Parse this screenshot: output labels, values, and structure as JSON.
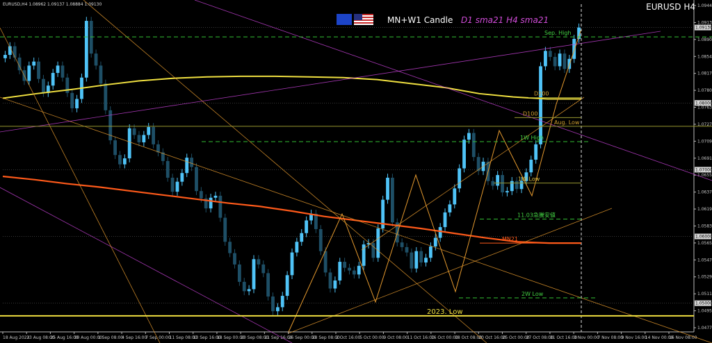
{
  "window": {
    "symbol_title": "EURUSD H4",
    "info_line": "EURUSD,H4  1.08962 1.09137 1.08884 1.09130"
  },
  "overlay": {
    "caption": "MN+W1 Candle",
    "ma_caption": "D1 sma21  H4 sma21",
    "flags": [
      "eu-flag-icon",
      "us-flag-icon"
    ]
  },
  "colors": {
    "background": "#000000",
    "bull": "#4fc3f7",
    "bear": "#1e4f66",
    "grid": "#303030",
    "sma_long": "#f0e040",
    "sma_d1": "#ff5a1a",
    "magenta": "#c040d0",
    "orange": "#e69a2e",
    "green_dash": "#34c234",
    "olive": "#9a9a30",
    "axis_text": "#c8c8c8"
  },
  "chart_data": {
    "type": "candlestick",
    "title": "EURUSD H4",
    "ylim": [
      1.0457,
      1.0948
    ],
    "y_ticks": [
      "1.09442",
      "1.09130",
      "1.08902",
      "1.08542",
      "1.08172",
      "1.07807",
      "1.07637",
      "1.07277",
      "1.07097",
      "1.06917",
      "1.06557",
      "1.06377",
      "1.06197",
      "1.05837",
      "1.05657",
      "1.05477",
      "1.05297",
      "1.05117",
      "1.04957",
      "1.04777"
    ],
    "y_highlights": [
      {
        "value": 1.0913,
        "label": "1.09130"
      },
      {
        "value": 1.08,
        "label": "1.08000"
      },
      {
        "value": 1.07,
        "label": "1.07000"
      },
      {
        "value": 1.06,
        "label": "1.06000"
      },
      {
        "value": 1.05,
        "label": "1.05000"
      }
    ],
    "x_ticks": [
      "18 Aug 2023",
      "23 Aug 08:00",
      "25 Aug 16:00",
      "30 Aug 00:00",
      "1 Sep 08:00",
      "4 Sep 16:00",
      "7 Sep 00:00",
      "11 Sep 08:00",
      "13 Sep 16:00",
      "18 Sep 00:00",
      "20 Sep 08:00",
      "21 Sep 16:00",
      "26 Sep 00:00",
      "28 Sep 08:00",
      "2 Oct 16:00",
      "5 Oct 00:00",
      "9 Oct 08:00",
      "11 Oct 16:00",
      "16 Oct 00:00",
      "18 Oct 08:00",
      "20 Oct 16:00",
      "25 Oct 00:00",
      "27 Oct 08:00",
      "31 Oct 16:00",
      "3 Nov 00:00",
      "7 Nov 08:00",
      "9 Nov 16:00",
      "14 Nov 00:00",
      "16 Nov 08:00"
    ],
    "close_path": [
      1.0872,
      1.0885,
      1.0868,
      1.0849,
      1.0833,
      1.0856,
      1.0862,
      1.0836,
      1.0815,
      1.0826,
      1.0845,
      1.0856,
      1.0838,
      1.0815,
      1.0792,
      1.0806,
      1.0838,
      1.0923,
      1.0874,
      1.0856,
      1.0829,
      1.0789,
      1.0744,
      1.0722,
      1.0708,
      1.0717,
      1.0762,
      1.0752,
      1.0741,
      1.0752,
      1.0764,
      1.0738,
      1.0726,
      1.0713,
      1.0688,
      1.0667,
      1.0682,
      1.0695,
      1.0718,
      1.0704,
      1.0668,
      1.0657,
      1.0642,
      1.0658,
      1.0661,
      1.0628,
      1.0592,
      1.0575,
      1.0558,
      1.0532,
      1.0518,
      1.0521,
      1.0566,
      1.0558,
      1.0545,
      1.051,
      1.0488,
      1.0494,
      1.0511,
      1.0542,
      1.0576,
      1.0592,
      1.0605,
      1.0624,
      1.0634,
      1.0611,
      1.0578,
      1.0546,
      1.0522,
      1.0534,
      1.0562,
      1.0553,
      1.0549,
      1.0543,
      1.0556,
      1.0588,
      1.059,
      1.0568,
      1.0612,
      1.0655,
      1.0688,
      1.0621,
      1.0591,
      1.0584,
      1.0576,
      1.0552,
      1.0578,
      1.0561,
      1.0568,
      1.0585,
      1.0598,
      1.0614,
      1.0636,
      1.0648,
      1.0672,
      1.0702,
      1.0745,
      1.0755,
      1.0719,
      1.0698,
      1.0712,
      1.0683,
      1.0676,
      1.0692,
      1.0666,
      1.0668,
      1.0683,
      1.0671,
      1.0683,
      1.0696,
      1.0715,
      1.0738,
      1.0855,
      1.0878,
      1.0869,
      1.0855,
      1.0874,
      1.0851,
      1.0866,
      1.0896,
      1.0913
    ],
    "sma_long": [
      1.0807,
      1.0814,
      1.082,
      1.0827,
      1.0833,
      1.0837,
      1.0839,
      1.084,
      1.084,
      1.0839,
      1.0838,
      1.0835,
      1.0829,
      1.0823,
      1.0814,
      1.0809,
      1.0806,
      1.0806
    ],
    "sma_d1": [
      1.069,
      1.0685,
      1.0679,
      1.0674,
      1.0668,
      1.0662,
      1.0656,
      1.065,
      1.0645,
      1.0638,
      1.063,
      1.0624,
      1.0618,
      1.0612,
      1.0605,
      1.0598,
      1.0592,
      1.059,
      1.059
    ],
    "levels": [
      {
        "label": "Sep. High",
        "value": 1.0899
      },
      {
        "label": "D200",
        "value": 1.0808
      },
      {
        "label": "D100",
        "value": 1.0778
      },
      {
        "label": "Aug. Low",
        "value": 1.0765
      },
      {
        "label": "1W High",
        "value": 1.0742
      },
      {
        "label": "1W Low",
        "value": 1.068
      },
      {
        "label": "11.03急騰安値",
        "value": 1.0626
      },
      {
        "label": "MN21",
        "value": 1.059
      },
      {
        "label": "2W Low",
        "value": 1.0508
      },
      {
        "label": "2023. Low",
        "value": 1.0481
      }
    ]
  }
}
